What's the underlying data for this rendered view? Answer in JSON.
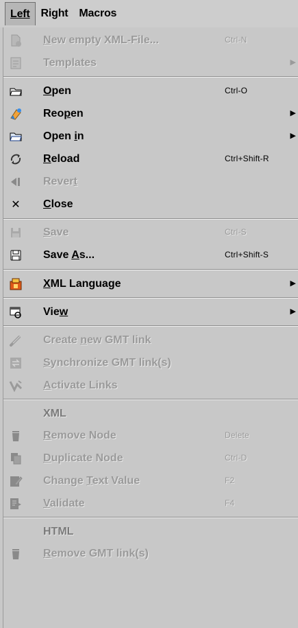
{
  "menubar": {
    "left": "Left",
    "right": "Right",
    "macros": "Macros"
  },
  "menu": {
    "new_file": {
      "label_pre": "",
      "label_u": "N",
      "label_post": "ew empty XML-File...",
      "accel": "Ctrl-N"
    },
    "templates": {
      "label": "Templates"
    },
    "open": {
      "label_u": "O",
      "label_post": "pen",
      "accel": "Ctrl-O"
    },
    "reopen": {
      "label_pre": "Reo",
      "label_u": "p",
      "label_post": "en"
    },
    "open_in": {
      "label_pre": "Open ",
      "label_u": "i",
      "label_post": "n"
    },
    "reload": {
      "label_u": "R",
      "label_post": "eload",
      "accel": "Ctrl+Shift-R"
    },
    "revert": {
      "label_pre": "Rever",
      "label_u": "t",
      "label_post": ""
    },
    "close": {
      "label_u": "C",
      "label_post": "lose"
    },
    "save": {
      "label_u": "S",
      "label_post": "ave",
      "accel": "Ctrl-S"
    },
    "save_as": {
      "label_pre": "Save ",
      "label_u": "A",
      "label_post": "s...",
      "accel": "Ctrl+Shift-S"
    },
    "xml_language": {
      "label_u": "X",
      "label_post": "ML Language"
    },
    "view": {
      "label_pre": "Vie",
      "label_u": "w",
      "label_post": ""
    },
    "create_gmt": {
      "label_pre": "Create ",
      "label_u": "n",
      "label_post": "ew GMT link"
    },
    "sync_gmt": {
      "label_u": "S",
      "label_post": "ynchronize GMT link(s)"
    },
    "activate_links": {
      "label_u": "A",
      "label_post": "ctivate Links"
    },
    "xml_header": "XML",
    "remove_node": {
      "label_u": "R",
      "label_post": "emove Node",
      "accel": "Delete"
    },
    "duplicate_node": {
      "label_u": "D",
      "label_post": "uplicate Node",
      "accel": "Ctrl-D"
    },
    "change_text": {
      "label_pre": "Change ",
      "label_u": "T",
      "label_post": "ext Value",
      "accel": "F2"
    },
    "validate": {
      "label_u": "V",
      "label_post": "alidate",
      "accel": "F4"
    },
    "html_header": "HTML",
    "remove_gmt": {
      "label_u": "R",
      "label_post": "emove GMT link(s)"
    }
  },
  "glyphs": {
    "submenu_arrow": "▶",
    "close_x": "✕"
  }
}
